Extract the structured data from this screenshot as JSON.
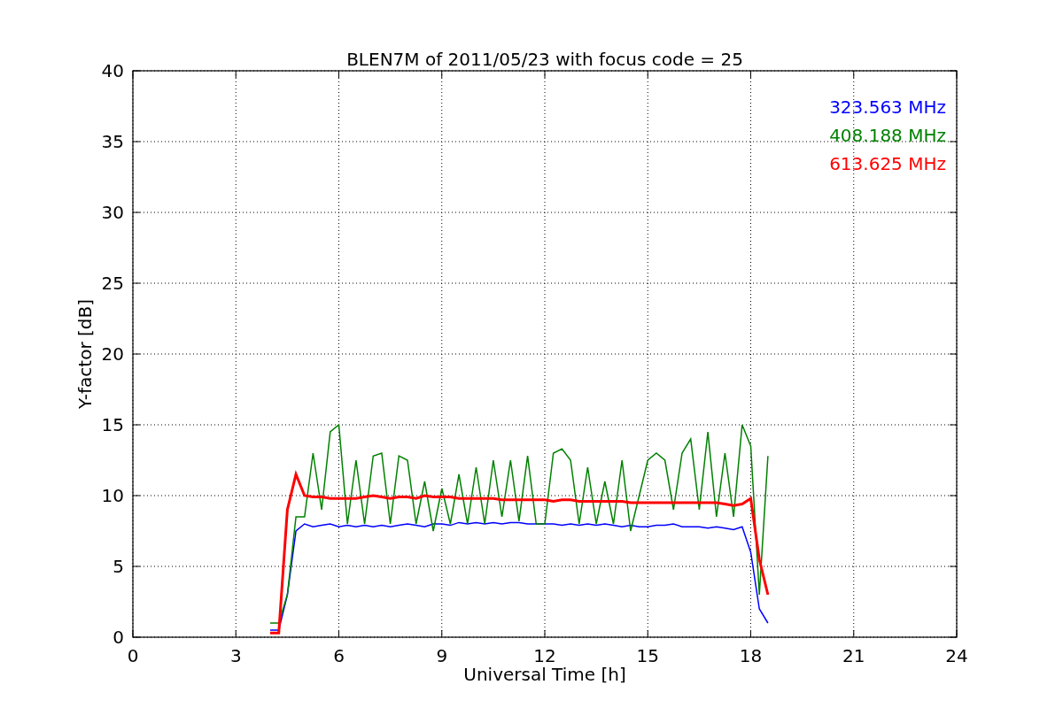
{
  "figure": {
    "chart_data": {
      "type": "line",
      "title": "BLEN7M of 2011/05/23 with focus code = 25",
      "xlabel": "Universal Time [h]",
      "ylabel": "Y-factor [dB]",
      "x": [
        4.0,
        4.25,
        4.5,
        4.75,
        5.0,
        5.25,
        5.5,
        5.75,
        6.0,
        6.25,
        6.5,
        6.75,
        7.0,
        7.25,
        7.5,
        7.75,
        8.0,
        8.25,
        8.5,
        8.75,
        9.0,
        9.25,
        9.5,
        9.75,
        10.0,
        10.25,
        10.5,
        10.75,
        11.0,
        11.25,
        11.5,
        11.75,
        12.0,
        12.25,
        12.5,
        12.75,
        13.0,
        13.25,
        13.5,
        13.75,
        14.0,
        14.25,
        14.5,
        14.75,
        15.0,
        15.25,
        15.5,
        15.75,
        16.0,
        16.25,
        16.5,
        16.75,
        17.0,
        17.25,
        17.5,
        17.75,
        18.0,
        18.25,
        18.5
      ],
      "series": [
        {
          "name": "323.563 MHz",
          "color": "#0000ff",
          "values": [
            0.5,
            0.5,
            3,
            7.5,
            8,
            7.8,
            7.9,
            8,
            7.8,
            7.9,
            7.8,
            7.9,
            7.8,
            7.9,
            7.8,
            7.9,
            8,
            7.9,
            7.8,
            8,
            8,
            7.9,
            8.1,
            8,
            8.1,
            8,
            8.1,
            8,
            8.1,
            8.1,
            8,
            8,
            8,
            8,
            7.9,
            8,
            7.9,
            8,
            7.9,
            8,
            7.9,
            7.8,
            7.9,
            7.8,
            7.8,
            7.9,
            7.9,
            8,
            7.8,
            7.8,
            7.8,
            7.7,
            7.8,
            7.7,
            7.6,
            7.8,
            6,
            2,
            1
          ]
        },
        {
          "name": "408.188 MHz",
          "color": "#008000",
          "values": [
            1,
            1,
            3,
            8.5,
            8.5,
            13,
            9,
            14.5,
            15,
            8,
            12.5,
            8,
            12.8,
            13,
            8,
            12.8,
            12.5,
            8,
            11,
            7.5,
            10.5,
            8,
            11.5,
            8,
            12,
            8,
            12.5,
            8.5,
            12.5,
            8.2,
            12.8,
            8,
            8,
            13,
            13.3,
            12.5,
            8,
            12,
            8,
            11,
            8,
            12.5,
            7.5,
            10,
            12.5,
            13,
            12.5,
            9,
            13,
            14,
            9,
            14.5,
            8.5,
            13,
            8.5,
            15,
            13.5,
            3,
            12.8
          ]
        },
        {
          "name": "613.625 MHz",
          "color": "#ff0000",
          "values": [
            0.3,
            0.3,
            9,
            11.5,
            10,
            9.9,
            9.9,
            9.8,
            9.8,
            9.8,
            9.8,
            9.9,
            10,
            9.9,
            9.8,
            9.9,
            9.9,
            9.8,
            10,
            9.9,
            9.9,
            9.9,
            9.8,
            9.8,
            9.8,
            9.8,
            9.8,
            9.7,
            9.7,
            9.7,
            9.7,
            9.7,
            9.7,
            9.6,
            9.7,
            9.7,
            9.6,
            9.6,
            9.6,
            9.6,
            9.6,
            9.6,
            9.5,
            9.5,
            9.5,
            9.5,
            9.5,
            9.5,
            9.5,
            9.5,
            9.5,
            9.5,
            9.5,
            9.4,
            9.3,
            9.4,
            9.8,
            5.5,
            3
          ]
        }
      ],
      "grid": true,
      "xlim": [
        0,
        24
      ],
      "ylim": [
        0,
        40
      ],
      "xticks": [
        0,
        3,
        6,
        9,
        12,
        15,
        18,
        21,
        24
      ],
      "yticks": [
        0,
        5,
        10,
        15,
        20,
        25,
        30,
        35,
        40
      ]
    }
  }
}
